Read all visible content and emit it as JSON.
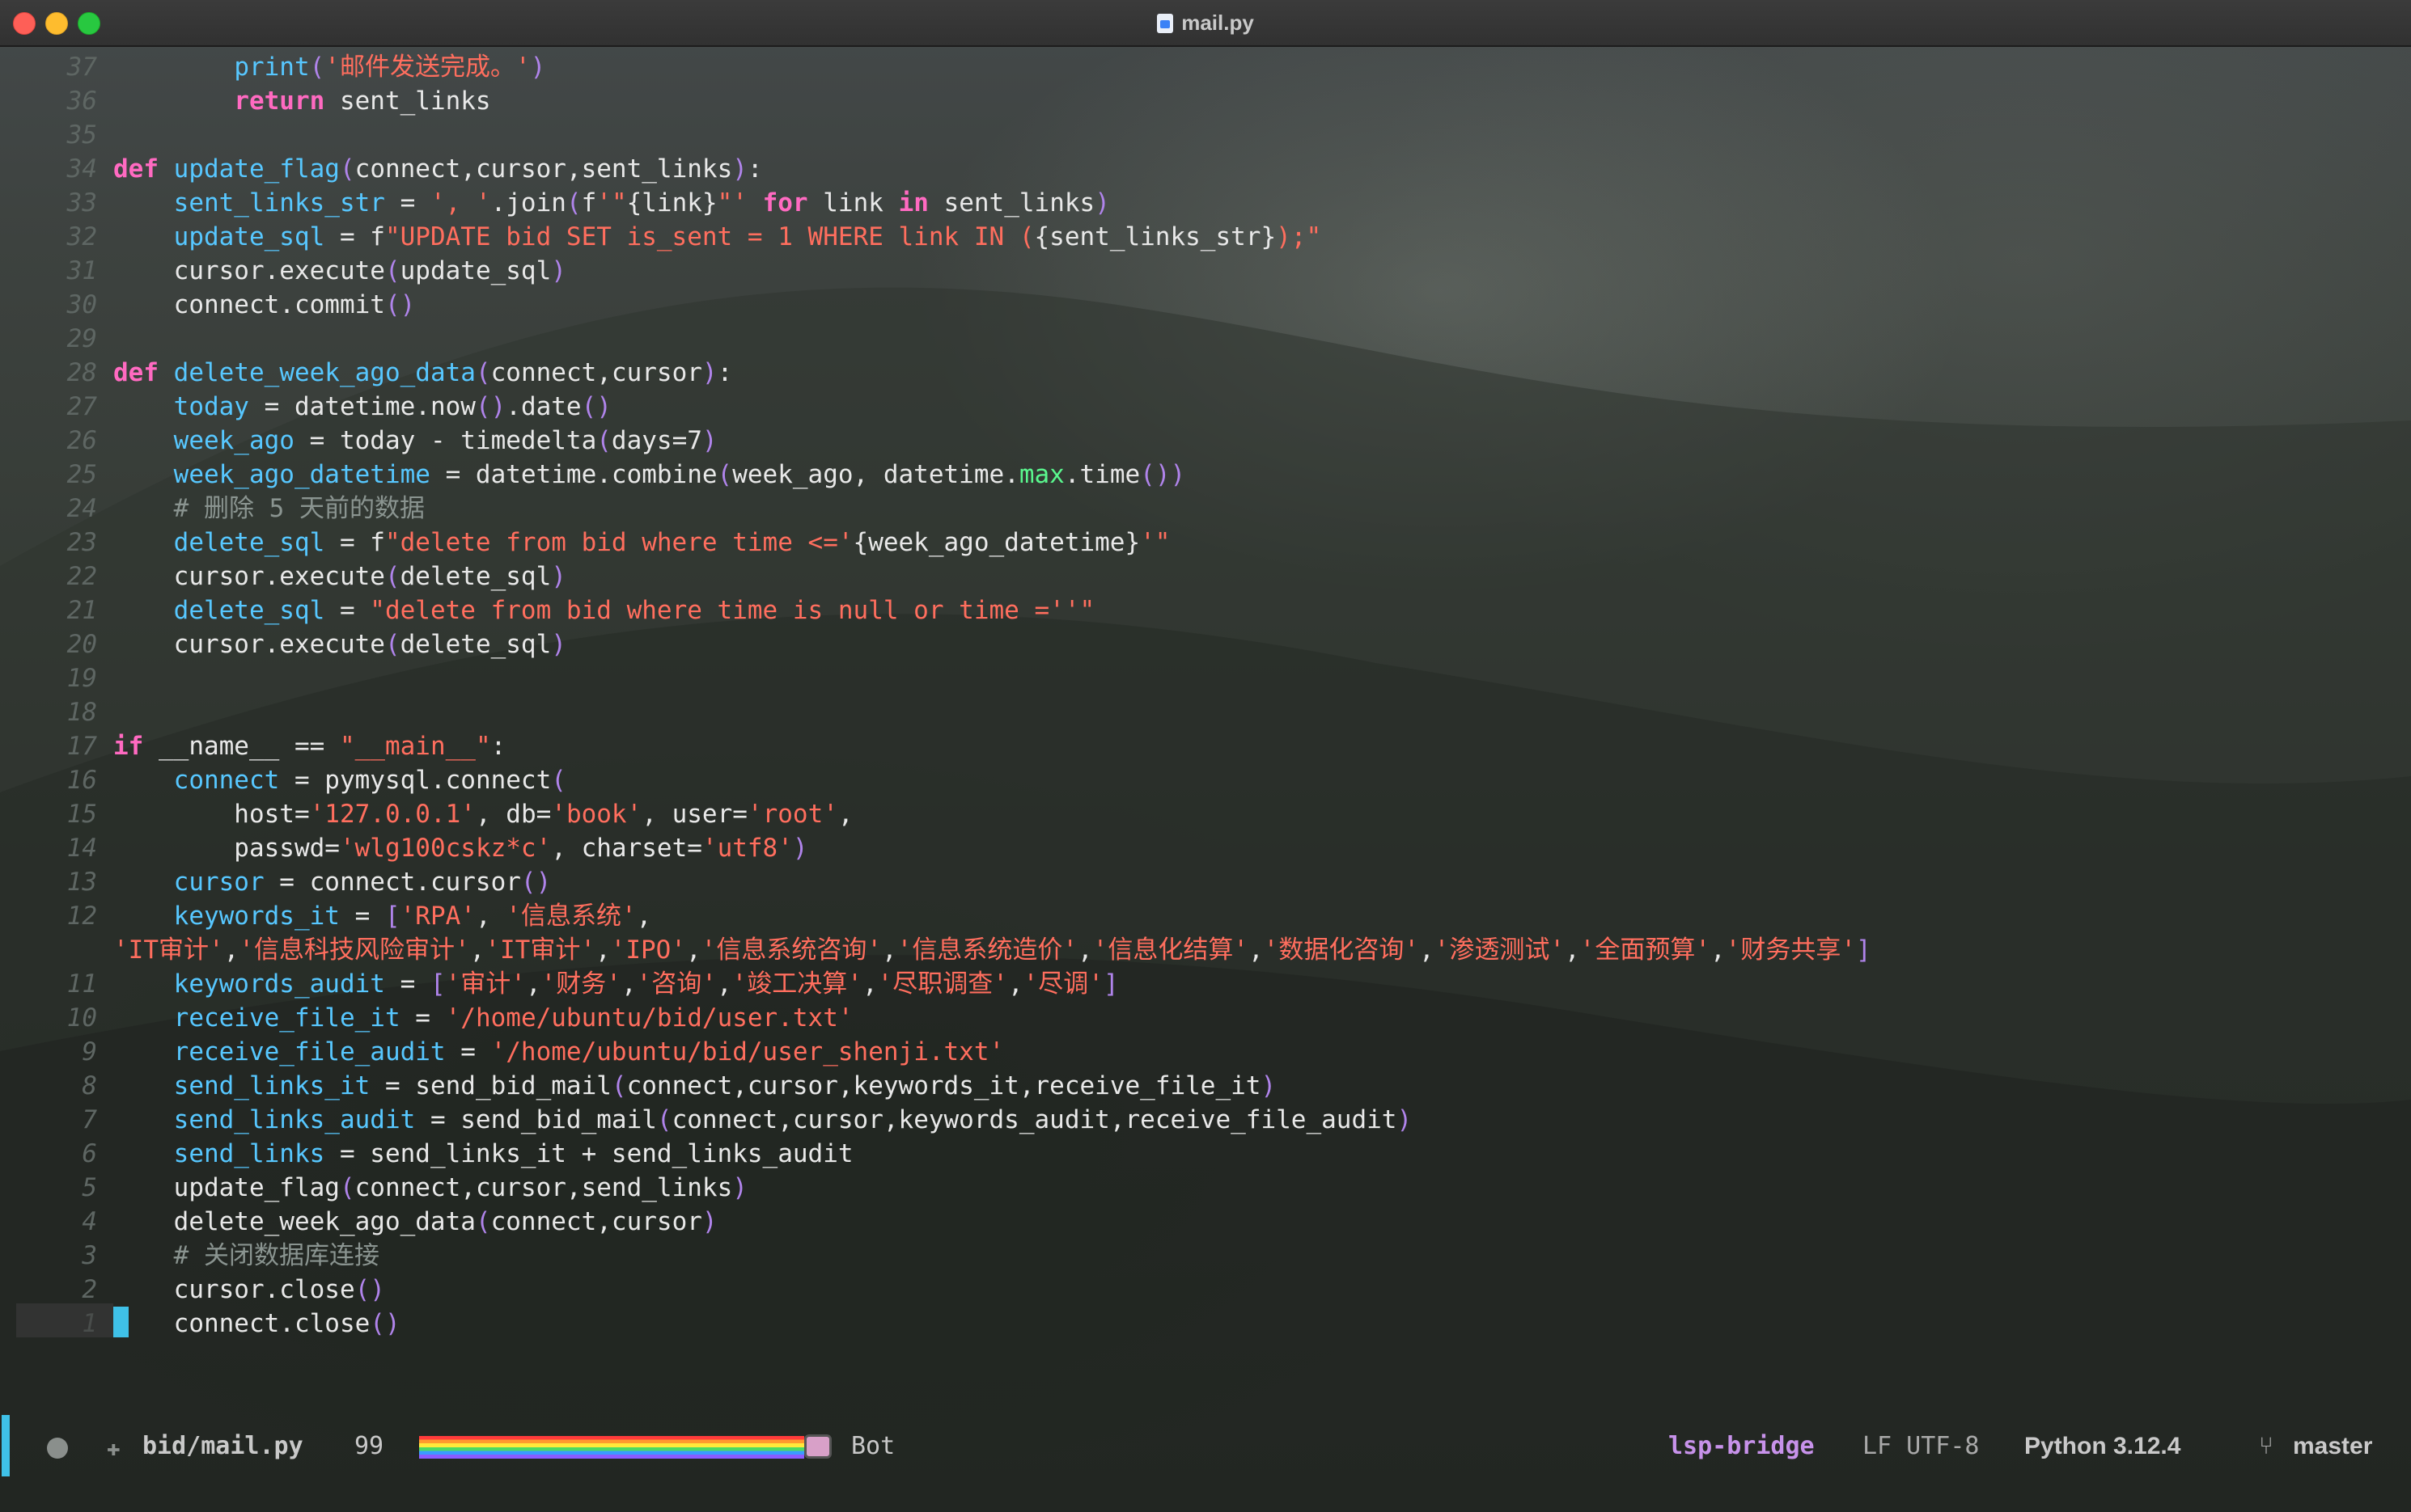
{
  "window": {
    "title": "mail.py"
  },
  "editor": {
    "lines": [
      {
        "num": "37",
        "tokens": [
          [
            "t",
            "        "
          ],
          [
            "fn",
            "print"
          ],
          [
            "paren",
            "("
          ],
          [
            "str",
            "'邮件发送完成。'"
          ],
          [
            "paren",
            ")"
          ]
        ]
      },
      {
        "num": "36",
        "tokens": [
          [
            "t",
            "        "
          ],
          [
            "kw",
            "return"
          ],
          [
            "t",
            " sent_links"
          ]
        ]
      },
      {
        "num": "35",
        "tokens": []
      },
      {
        "num": "34",
        "tokens": [
          [
            "kw",
            "def"
          ],
          [
            "t",
            " "
          ],
          [
            "fn",
            "update_flag"
          ],
          [
            "paren",
            "("
          ],
          [
            "t",
            "connect,cursor,sent_links"
          ],
          [
            "paren",
            ")"
          ],
          [
            "t",
            ":"
          ]
        ]
      },
      {
        "num": "33",
        "tokens": [
          [
            "t",
            "    "
          ],
          [
            "var",
            "sent_links_str"
          ],
          [
            "t",
            " = "
          ],
          [
            "str",
            "', '"
          ],
          [
            "t",
            ".join"
          ],
          [
            "paren",
            "("
          ],
          [
            "t",
            "f"
          ],
          [
            "str",
            "'\""
          ],
          [
            "t",
            "{link}"
          ],
          [
            "str",
            "\"'"
          ],
          [
            "t",
            " "
          ],
          [
            "kw",
            "for"
          ],
          [
            "t",
            " link "
          ],
          [
            "kw",
            "in"
          ],
          [
            "t",
            " sent_links"
          ],
          [
            "paren",
            ")"
          ]
        ]
      },
      {
        "num": "32",
        "tokens": [
          [
            "t",
            "    "
          ],
          [
            "var",
            "update_sql"
          ],
          [
            "t",
            " = f"
          ],
          [
            "str",
            "\"UPDATE bid SET is_sent = 1 WHERE link IN ("
          ],
          [
            "t",
            "{sent_links_str}"
          ],
          [
            "str",
            ");\""
          ]
        ]
      },
      {
        "num": "31",
        "tokens": [
          [
            "t",
            "    cursor.execute"
          ],
          [
            "paren",
            "("
          ],
          [
            "t",
            "update_sql"
          ],
          [
            "paren",
            ")"
          ]
        ]
      },
      {
        "num": "30",
        "tokens": [
          [
            "t",
            "    connect.commit"
          ],
          [
            "paren",
            "()"
          ]
        ]
      },
      {
        "num": "29",
        "tokens": []
      },
      {
        "num": "28",
        "tokens": [
          [
            "kw",
            "def"
          ],
          [
            "t",
            " "
          ],
          [
            "fn",
            "delete_week_ago_data"
          ],
          [
            "paren",
            "("
          ],
          [
            "t",
            "connect,cursor"
          ],
          [
            "paren",
            ")"
          ],
          [
            "t",
            ":"
          ]
        ]
      },
      {
        "num": "27",
        "tokens": [
          [
            "t",
            "    "
          ],
          [
            "var",
            "today"
          ],
          [
            "t",
            " = datetime.now"
          ],
          [
            "paren",
            "()"
          ],
          [
            "t",
            ".date"
          ],
          [
            "paren",
            "()"
          ]
        ]
      },
      {
        "num": "26",
        "tokens": [
          [
            "t",
            "    "
          ],
          [
            "var",
            "week_ago"
          ],
          [
            "t",
            " = today - timedelta"
          ],
          [
            "paren",
            "("
          ],
          [
            "t",
            "days=7"
          ],
          [
            "paren",
            ")"
          ]
        ]
      },
      {
        "num": "25",
        "tokens": [
          [
            "t",
            "    "
          ],
          [
            "var",
            "week_ago_datetime"
          ],
          [
            "t",
            " = datetime.combine"
          ],
          [
            "paren",
            "("
          ],
          [
            "t",
            "week_ago, datetime."
          ],
          [
            "attr",
            "max"
          ],
          [
            "t",
            ".time"
          ],
          [
            "paren",
            "())"
          ]
        ]
      },
      {
        "num": "24",
        "tokens": [
          [
            "t",
            "    "
          ],
          [
            "cm",
            "# 删除 5 天前的数据"
          ]
        ]
      },
      {
        "num": "23",
        "tokens": [
          [
            "t",
            "    "
          ],
          [
            "var",
            "delete_sql"
          ],
          [
            "t",
            " = f"
          ],
          [
            "str",
            "\"delete from bid where time <='"
          ],
          [
            "t",
            "{week_ago_datetime}"
          ],
          [
            "str",
            "'\""
          ]
        ]
      },
      {
        "num": "22",
        "tokens": [
          [
            "t",
            "    cursor.execute"
          ],
          [
            "paren",
            "("
          ],
          [
            "t",
            "delete_sql"
          ],
          [
            "paren",
            ")"
          ]
        ]
      },
      {
        "num": "21",
        "tokens": [
          [
            "t",
            "    "
          ],
          [
            "var",
            "delete_sql"
          ],
          [
            "t",
            " = "
          ],
          [
            "str",
            "\"delete from bid where time is null or time =''\""
          ]
        ]
      },
      {
        "num": "20",
        "tokens": [
          [
            "t",
            "    cursor.execute"
          ],
          [
            "paren",
            "("
          ],
          [
            "t",
            "delete_sql"
          ],
          [
            "paren",
            ")"
          ]
        ]
      },
      {
        "num": "19",
        "tokens": []
      },
      {
        "num": "18",
        "tokens": []
      },
      {
        "num": "17",
        "tokens": [
          [
            "kw",
            "if"
          ],
          [
            "t",
            " __name__ == "
          ],
          [
            "str",
            "\"__main__\""
          ],
          [
            "t",
            ":"
          ]
        ]
      },
      {
        "num": "16",
        "tokens": [
          [
            "t",
            "    "
          ],
          [
            "var",
            "connect"
          ],
          [
            "t",
            " = pymysql.connect"
          ],
          [
            "paren",
            "("
          ]
        ]
      },
      {
        "num": "15",
        "tokens": [
          [
            "t",
            "        host="
          ],
          [
            "str",
            "'127.0.0.1'"
          ],
          [
            "t",
            ", db="
          ],
          [
            "str",
            "'book'"
          ],
          [
            "t",
            ", user="
          ],
          [
            "str",
            "'root'"
          ],
          [
            "t",
            ","
          ]
        ]
      },
      {
        "num": "14",
        "tokens": [
          [
            "t",
            "        passwd="
          ],
          [
            "str",
            "'wlg100cskz*c'"
          ],
          [
            "t",
            ", charset="
          ],
          [
            "str",
            "'utf8'"
          ],
          [
            "paren",
            ")"
          ]
        ]
      },
      {
        "num": "13",
        "tokens": [
          [
            "t",
            "    "
          ],
          [
            "var",
            "cursor"
          ],
          [
            "t",
            " = connect.cursor"
          ],
          [
            "paren",
            "()"
          ]
        ]
      },
      {
        "num": "12",
        "tokens": [
          [
            "t",
            "    "
          ],
          [
            "var",
            "keywords_it"
          ],
          [
            "t",
            " = "
          ],
          [
            "paren",
            "["
          ],
          [
            "str",
            "'RPA'"
          ],
          [
            "t",
            ", "
          ],
          [
            "str",
            "'信息系统'"
          ],
          [
            "t",
            ","
          ]
        ]
      },
      {
        "num": "",
        "tokens": [
          [
            "str",
            "'IT审计'"
          ],
          [
            "t",
            ","
          ],
          [
            "str",
            "'信息科技风险审计'"
          ],
          [
            "t",
            ","
          ],
          [
            "str",
            "'IT审计'"
          ],
          [
            "t",
            ","
          ],
          [
            "str",
            "'IPO'"
          ],
          [
            "t",
            ","
          ],
          [
            "str",
            "'信息系统咨询'"
          ],
          [
            "t",
            ","
          ],
          [
            "str",
            "'信息系统造价'"
          ],
          [
            "t",
            ","
          ],
          [
            "str",
            "'信息化结算'"
          ],
          [
            "t",
            ","
          ],
          [
            "str",
            "'数据化咨询'"
          ],
          [
            "t",
            ","
          ],
          [
            "str",
            "'渗透测试'"
          ],
          [
            "t",
            ","
          ],
          [
            "str",
            "'全面预算'"
          ],
          [
            "t",
            ","
          ],
          [
            "str",
            "'财务共享'"
          ],
          [
            "paren",
            "]"
          ]
        ]
      },
      {
        "num": "11",
        "tokens": [
          [
            "t",
            "    "
          ],
          [
            "var",
            "keywords_audit"
          ],
          [
            "t",
            " = "
          ],
          [
            "paren",
            "["
          ],
          [
            "str",
            "'审计'"
          ],
          [
            "t",
            ","
          ],
          [
            "str",
            "'财务'"
          ],
          [
            "t",
            ","
          ],
          [
            "str",
            "'咨询'"
          ],
          [
            "t",
            ","
          ],
          [
            "str",
            "'竣工决算'"
          ],
          [
            "t",
            ","
          ],
          [
            "str",
            "'尽职调查'"
          ],
          [
            "t",
            ","
          ],
          [
            "str",
            "'尽调'"
          ],
          [
            "paren",
            "]"
          ]
        ]
      },
      {
        "num": "10",
        "tokens": [
          [
            "t",
            "    "
          ],
          [
            "var",
            "receive_file_it"
          ],
          [
            "t",
            " = "
          ],
          [
            "str",
            "'/home/ubuntu/bid/user.txt'"
          ]
        ]
      },
      {
        "num": "9",
        "tokens": [
          [
            "t",
            "    "
          ],
          [
            "var",
            "receive_file_audit"
          ],
          [
            "t",
            " = "
          ],
          [
            "str",
            "'/home/ubuntu/bid/user_shenji.txt'"
          ]
        ]
      },
      {
        "num": "8",
        "tokens": [
          [
            "t",
            "    "
          ],
          [
            "var",
            "send_links_it"
          ],
          [
            "t",
            " = send_bid_mail"
          ],
          [
            "paren",
            "("
          ],
          [
            "t",
            "connect,cursor,keywords_it,receive_file_it"
          ],
          [
            "paren",
            ")"
          ]
        ]
      },
      {
        "num": "7",
        "tokens": [
          [
            "t",
            "    "
          ],
          [
            "var",
            "send_links_audit"
          ],
          [
            "t",
            " = send_bid_mail"
          ],
          [
            "paren",
            "("
          ],
          [
            "t",
            "connect,cursor,keywords_audit,receive_file_audit"
          ],
          [
            "paren",
            ")"
          ]
        ]
      },
      {
        "num": "6",
        "tokens": [
          [
            "t",
            "    "
          ],
          [
            "var",
            "send_links"
          ],
          [
            "t",
            " = send_links_it + send_links_audit"
          ]
        ]
      },
      {
        "num": "5",
        "tokens": [
          [
            "t",
            "    update_flag"
          ],
          [
            "paren",
            "("
          ],
          [
            "t",
            "connect,cursor,send_links"
          ],
          [
            "paren",
            ")"
          ]
        ]
      },
      {
        "num": "4",
        "tokens": [
          [
            "t",
            "    delete_week_ago_data"
          ],
          [
            "paren",
            "("
          ],
          [
            "t",
            "connect,cursor"
          ],
          [
            "paren",
            ")"
          ]
        ]
      },
      {
        "num": "3",
        "tokens": [
          [
            "t",
            "    "
          ],
          [
            "cm",
            "# 关闭数据库连接"
          ]
        ]
      },
      {
        "num": "2",
        "tokens": [
          [
            "t",
            "    cursor.close"
          ],
          [
            "paren",
            "()"
          ]
        ]
      },
      {
        "num": "1",
        "tokens": [
          [
            "t",
            "    connect.close"
          ],
          [
            "paren",
            "()"
          ]
        ]
      }
    ]
  },
  "modeline": {
    "file": "bid/mail.py",
    "percent": "99",
    "position": "Bot",
    "lsp": "lsp-bridge",
    "encoding": "LF UTF-8",
    "language": "Python 3.12.4",
    "branch": "master",
    "branch_icon": "git-branch-icon",
    "accent": "#3fc1e8"
  }
}
